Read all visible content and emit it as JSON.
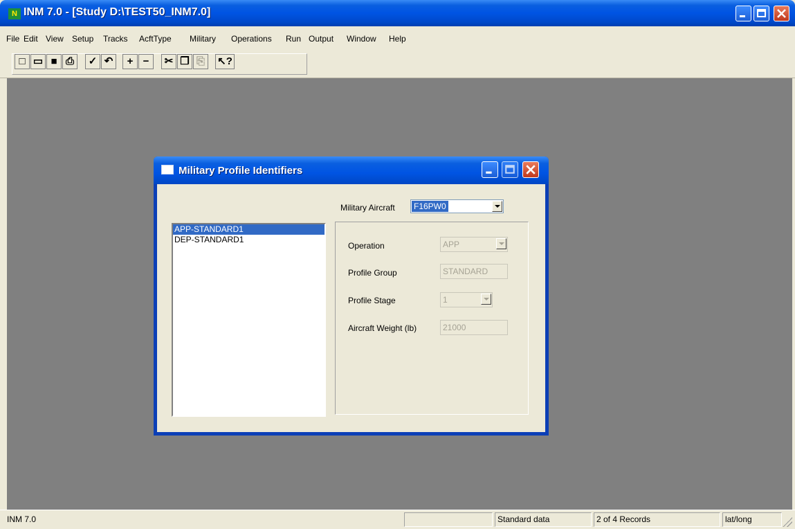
{
  "window": {
    "app_icon_text": "N",
    "title": "INM 7.0 - [Study D:\\TEST50_INM7.0]"
  },
  "menu": [
    "File",
    "Edit",
    "View",
    "Setup",
    "Tracks",
    "AcftType",
    "Military",
    "Operations",
    "Run",
    "Output",
    "Window",
    "Help"
  ],
  "toolbar": {
    "buttons": [
      {
        "icon": "new-document-icon",
        "glyph": "□"
      },
      {
        "icon": "open-folder-icon",
        "glyph": "▭"
      },
      {
        "icon": "save-disk-icon",
        "glyph": "■"
      },
      {
        "icon": "print-icon",
        "glyph": "⎙"
      },
      {
        "icon": "commit-check-icon",
        "glyph": "✓"
      },
      {
        "icon": "undo-icon",
        "glyph": "↶"
      },
      {
        "icon": "add-record-icon",
        "glyph": "+"
      },
      {
        "icon": "delete-record-icon",
        "glyph": "−"
      },
      {
        "icon": "cut-icon",
        "glyph": "✂"
      },
      {
        "icon": "copy-icon",
        "glyph": "❐"
      },
      {
        "icon": "paste-icon",
        "glyph": "⎘",
        "disabled": true
      },
      {
        "icon": "context-help-icon",
        "glyph": "↖?"
      }
    ]
  },
  "dialog": {
    "title": "Military Profile Identifiers",
    "military_aircraft_label": "Military Aircraft",
    "military_aircraft_value": "F16PW0",
    "profiles": [
      {
        "label": "APP-STANDARD1",
        "selected": true
      },
      {
        "label": "DEP-STANDARD1",
        "selected": false
      }
    ],
    "fields": {
      "operation_label": "Operation",
      "operation_value": "APP",
      "profile_group_label": "Profile Group",
      "profile_group_value": "STANDARD",
      "profile_stage_label": "Profile Stage",
      "profile_stage_value": "1",
      "aircraft_weight_label": "Aircraft Weight (lb)",
      "aircraft_weight_value": "21000"
    }
  },
  "status": {
    "app": "INM 7.0",
    "blank": "",
    "data_source": "Standard data",
    "records": "2 of 4 Records",
    "coords": "lat/long"
  },
  "colors": {
    "titlebar": "#0054e3",
    "selection": "#316ac5",
    "client_bg": "#808080",
    "close_button": "#c1391d"
  }
}
